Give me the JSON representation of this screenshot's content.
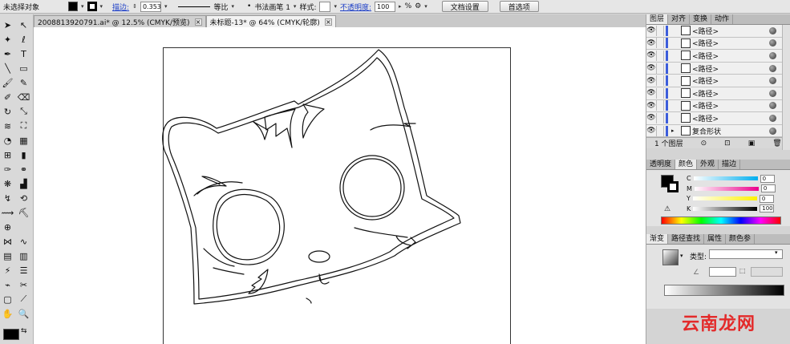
{
  "control_bar": {
    "selection_status": "未选择对象",
    "stroke_label": "描边:",
    "stroke_value": "0.353",
    "profile_label": "等比",
    "brush_label": "书法画笔 1",
    "style_label": "样式:",
    "opacity_label": "不透明度:",
    "opacity_value": "100",
    "opacity_unit": "%",
    "doc_setup_button": "文档设置",
    "preferences_button": "首选项"
  },
  "document_tabs": [
    {
      "label": "2008813920791.ai* @ 12.5% (CMYK/预览)",
      "close": "×",
      "active": false
    },
    {
      "label": "未标题-13* @ 64% (CMYK/轮廓)",
      "close": "×",
      "active": true
    }
  ],
  "layers_panel": {
    "tabs": [
      "图层",
      "对齐",
      "变换",
      "动作"
    ],
    "rows": [
      {
        "name": "<路径>"
      },
      {
        "name": "<路径>"
      },
      {
        "name": "<路径>"
      },
      {
        "name": "<路径>"
      },
      {
        "name": "<路径>"
      },
      {
        "name": "<路径>"
      },
      {
        "name": "<路径>"
      },
      {
        "name": "<路径>"
      },
      {
        "name": "复合形状"
      }
    ],
    "footer_count": "1 个图层"
  },
  "color_panel": {
    "tabs": [
      "透明度",
      "颜色",
      "外观",
      "描边"
    ],
    "channels": [
      {
        "label": "C",
        "value": "0",
        "color": "#00aeef"
      },
      {
        "label": "M",
        "value": "0",
        "color": "#ec008c"
      },
      {
        "label": "Y",
        "value": "0",
        "color": "#fff200"
      },
      {
        "label": "K",
        "value": "100",
        "color": "#000000"
      }
    ]
  },
  "gradient_panel": {
    "tabs": [
      "渐变",
      "路径查找",
      "属性",
      "颜色参"
    ],
    "type_label": "类型:",
    "angle_icon": "angle-icon"
  },
  "watermark": "云南龙网",
  "colors": {
    "toolbar_bg": "#e6e6e6",
    "panel_bg": "#d4d4d4",
    "link_blue": "#1c3ec6",
    "watermark_red": "#e32a2a"
  }
}
